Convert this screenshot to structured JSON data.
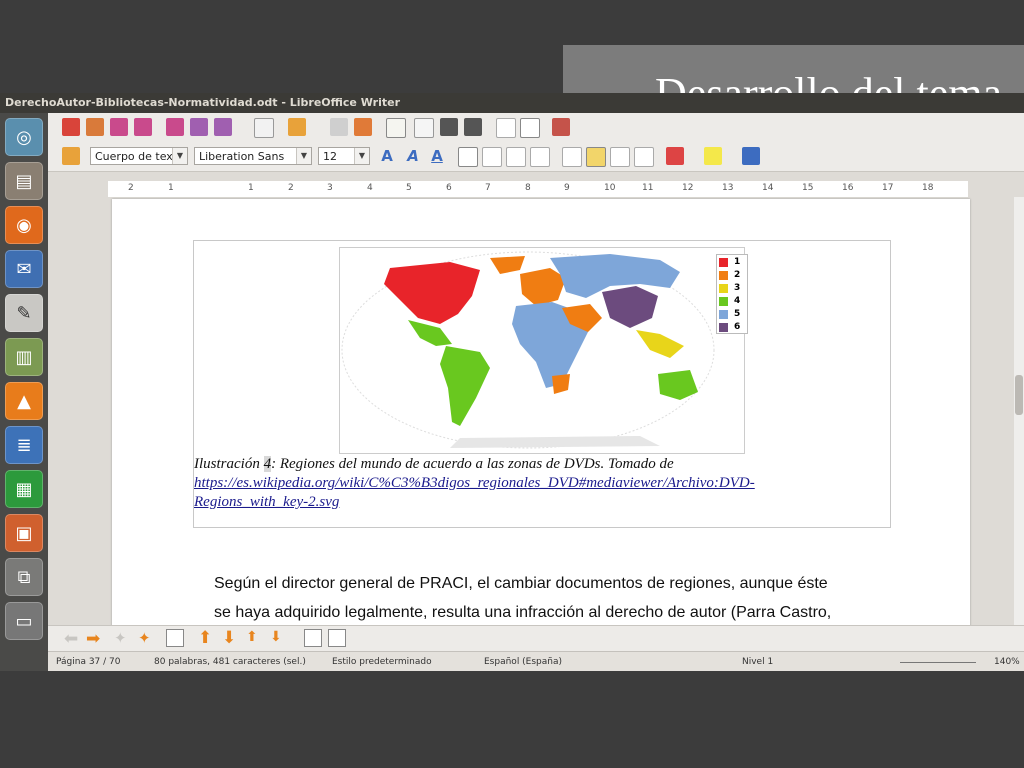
{
  "slide": {
    "title": "Desarrollo del tema"
  },
  "window": {
    "title": "DerechoAutor-Bibliotecas-Normatividad.odt - LibreOffice Writer"
  },
  "formatting": {
    "paragraph_style": "Cuerpo de text",
    "font_name": "Liberation Sans",
    "font_size": "12"
  },
  "ruler": {
    "ticks": [
      "2",
      "1",
      "1",
      "2",
      "3",
      "4",
      "5",
      "6",
      "7",
      "8",
      "9",
      "10",
      "11",
      "12",
      "13",
      "14",
      "15",
      "16",
      "17",
      "18"
    ]
  },
  "figure": {
    "legend": [
      {
        "label": "1",
        "color": "#e8242a"
      },
      {
        "label": "2",
        "color": "#f07d12"
      },
      {
        "label": "3",
        "color": "#e8d51a"
      },
      {
        "label": "4",
        "color": "#69c81f"
      },
      {
        "label": "5",
        "color": "#7ea6d9"
      },
      {
        "label": "6",
        "color": "#6c4b7e"
      }
    ],
    "caption_prefix": "Ilustración ",
    "caption_number": "4",
    "caption_text": ": Regiones del mundo de acuerdo a las zonas de DVDs.  Tomado de",
    "caption_link_line1": "https://es.wikipedia.org/wiki/C%C3%B3digos_regionales_DVD#mediaviewer/Archivo:DVD-",
    "caption_link_line2": "Regions_with_key-2.svg"
  },
  "body": {
    "line1": "Según el director general de PRACI, el cambiar documentos de regiones, aunque éste",
    "line2": "se haya adquirido legalmente, resulta una infracción al derecho de autor (Parra Castro,"
  },
  "status": {
    "page": "Página 37 / 70",
    "words": "80 palabras, 481 caracteres (sel.)",
    "style": "Estilo predeterminado",
    "language": "Español (España)",
    "level": "Nivel 1",
    "zoom": "140%"
  }
}
